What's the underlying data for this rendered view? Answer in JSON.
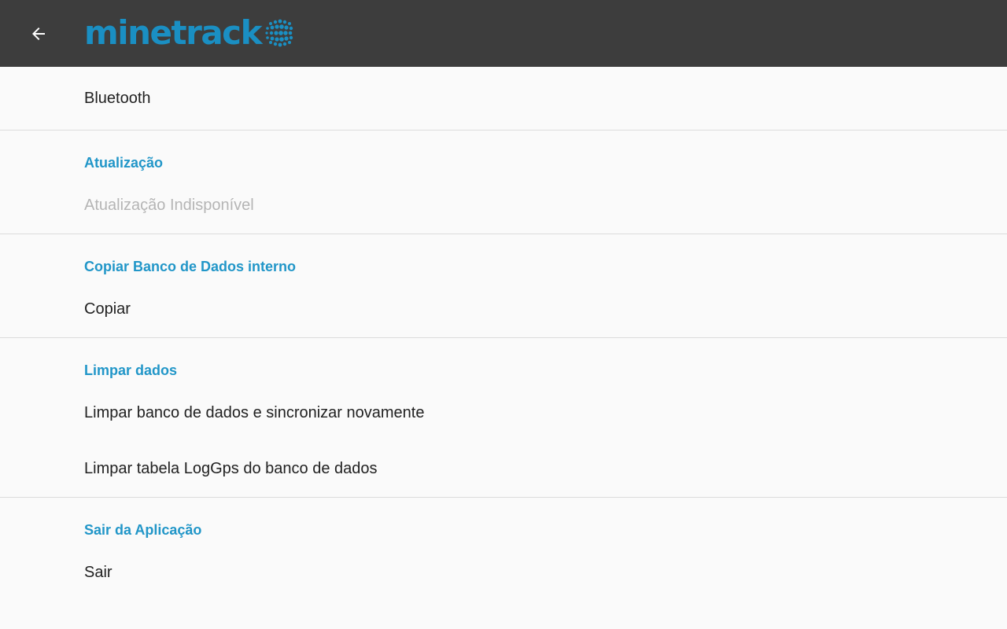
{
  "appbar": {
    "back_icon": "arrow-back-icon",
    "logo_text": "minetrack",
    "logo_icon": "dot-globe-icon",
    "background": "#3d3d3d",
    "brand_color": "#1a8fc3"
  },
  "accent_color": "#2196c8",
  "sections": [
    {
      "category": "",
      "items": [
        {
          "label": "Bluetooth",
          "enabled": true
        }
      ]
    },
    {
      "category": "Atualização",
      "items": [
        {
          "label": "Atualização Indisponível",
          "enabled": false
        }
      ]
    },
    {
      "category": "Copiar Banco de Dados interno",
      "items": [
        {
          "label": "Copiar",
          "enabled": true
        }
      ]
    },
    {
      "category": "Limpar dados",
      "items": [
        {
          "label": "Limpar banco de dados e sincronizar novamente",
          "enabled": true
        },
        {
          "label": "Limpar tabela LogGps do banco de dados",
          "enabled": true
        }
      ]
    },
    {
      "category": "Sair da Aplicação",
      "items": [
        {
          "label": "Sair",
          "enabled": true
        }
      ]
    }
  ]
}
